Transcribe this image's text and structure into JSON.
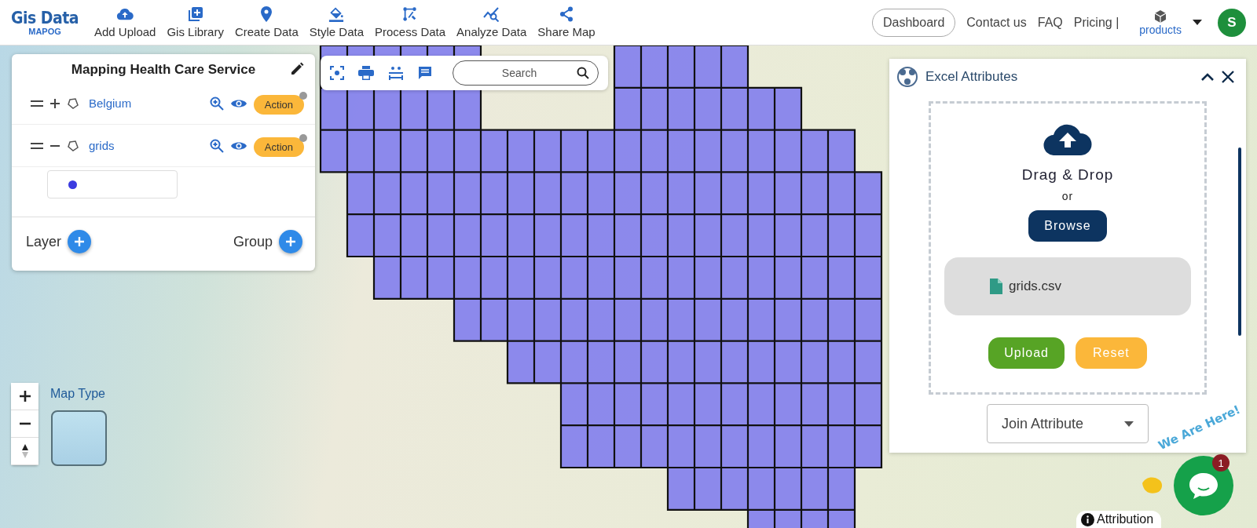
{
  "logo": {
    "title": "Gis Data",
    "subtitle": "MAPOG"
  },
  "nav": [
    {
      "label": "Add Upload",
      "kind": "upload"
    },
    {
      "label": "Gis Library",
      "kind": "library"
    },
    {
      "label": "Create Data",
      "kind": "pin"
    },
    {
      "label": "Style Data",
      "kind": "style"
    },
    {
      "label": "Process Data",
      "kind": "process"
    },
    {
      "label": "Analyze Data",
      "kind": "analyze"
    },
    {
      "label": "Share Map",
      "kind": "share"
    }
  ],
  "header_right": {
    "dashboard": "Dashboard",
    "links": [
      "Contact us",
      "FAQ",
      "Pricing |"
    ],
    "products": "products",
    "avatar": "S"
  },
  "layer_panel": {
    "title": "Mapping Health Care Service",
    "layers": [
      {
        "name": "Belgium",
        "expanded": false,
        "action": "Action"
      },
      {
        "name": "grids",
        "expanded": true,
        "action": "Action"
      }
    ],
    "add_layer": "Layer",
    "add_group": "Group"
  },
  "map_toolbar": {
    "search_placeholder": "Search"
  },
  "map_controls": {
    "map_type": "Map Type"
  },
  "excel_panel": {
    "title": "Excel Attributes",
    "drag_drop": "Drag & Drop",
    "or": "or",
    "browse": "Browse",
    "file": "grids.csv",
    "upload": "Upload",
    "reset": "Reset",
    "join": "Join Attribute"
  },
  "chat": {
    "tagline": "We Are Here!",
    "badge": "1"
  },
  "attribution": "Attribution"
}
